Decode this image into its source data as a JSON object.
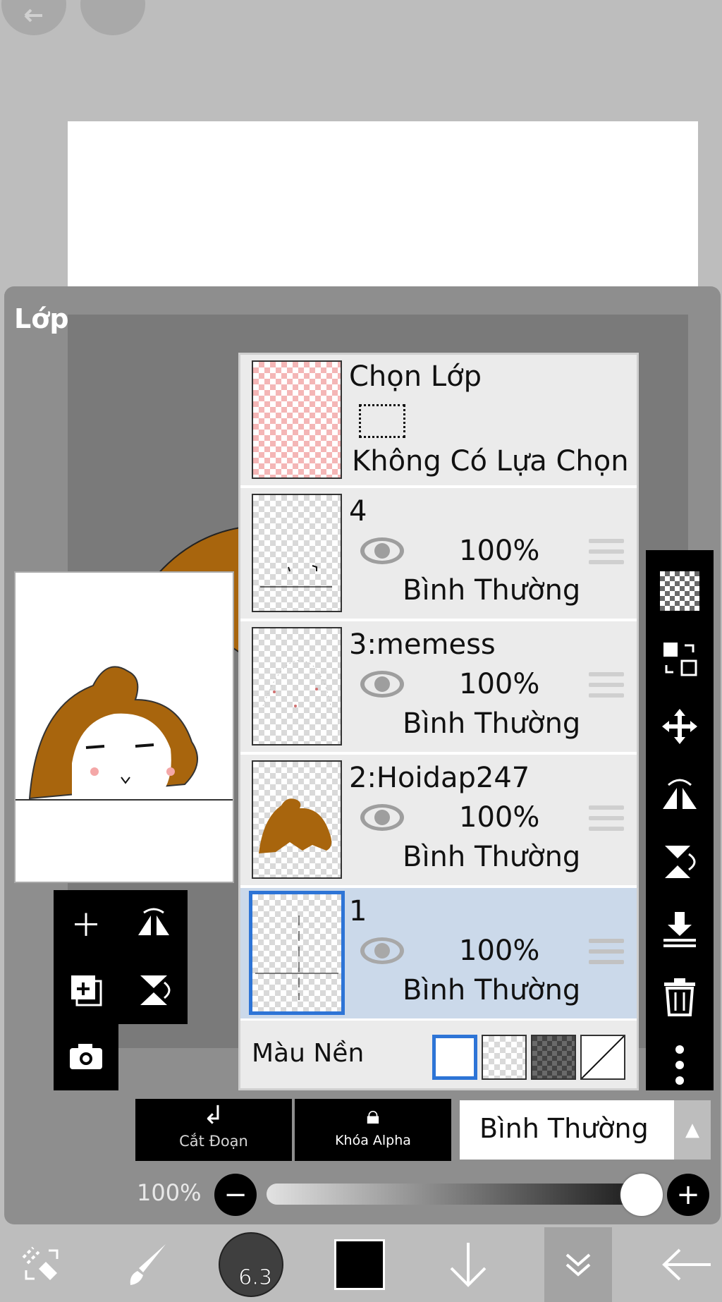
{
  "panel": {
    "title": "Lớp"
  },
  "selection_layer": {
    "title": "Chọn Lớp",
    "status": "Không Có Lựa Chọn"
  },
  "layers": [
    {
      "name": "4",
      "opacity": "100%",
      "blend": "Bình Thường"
    },
    {
      "name": "3:memess",
      "opacity": "100%",
      "blend": "Bình Thường"
    },
    {
      "name": "2:Hoidap247",
      "opacity": "100%",
      "blend": "Bình Thường"
    },
    {
      "name": "1",
      "opacity": "100%",
      "blend": "Bình Thường"
    }
  ],
  "background": {
    "label": "Màu Nền"
  },
  "actions": {
    "cut_label": "Cắt Đoạn",
    "alpha_label": "Khóa Alpha"
  },
  "blend_mode": {
    "value": "Bình Thường"
  },
  "opacity": {
    "value": "100%",
    "level": 1.0
  },
  "brush": {
    "size": "6.3"
  },
  "colors": {
    "accent": "#2d74d6",
    "active_row": "#cbd9ea",
    "hair": "#a8650d",
    "current_color": "#000000"
  }
}
